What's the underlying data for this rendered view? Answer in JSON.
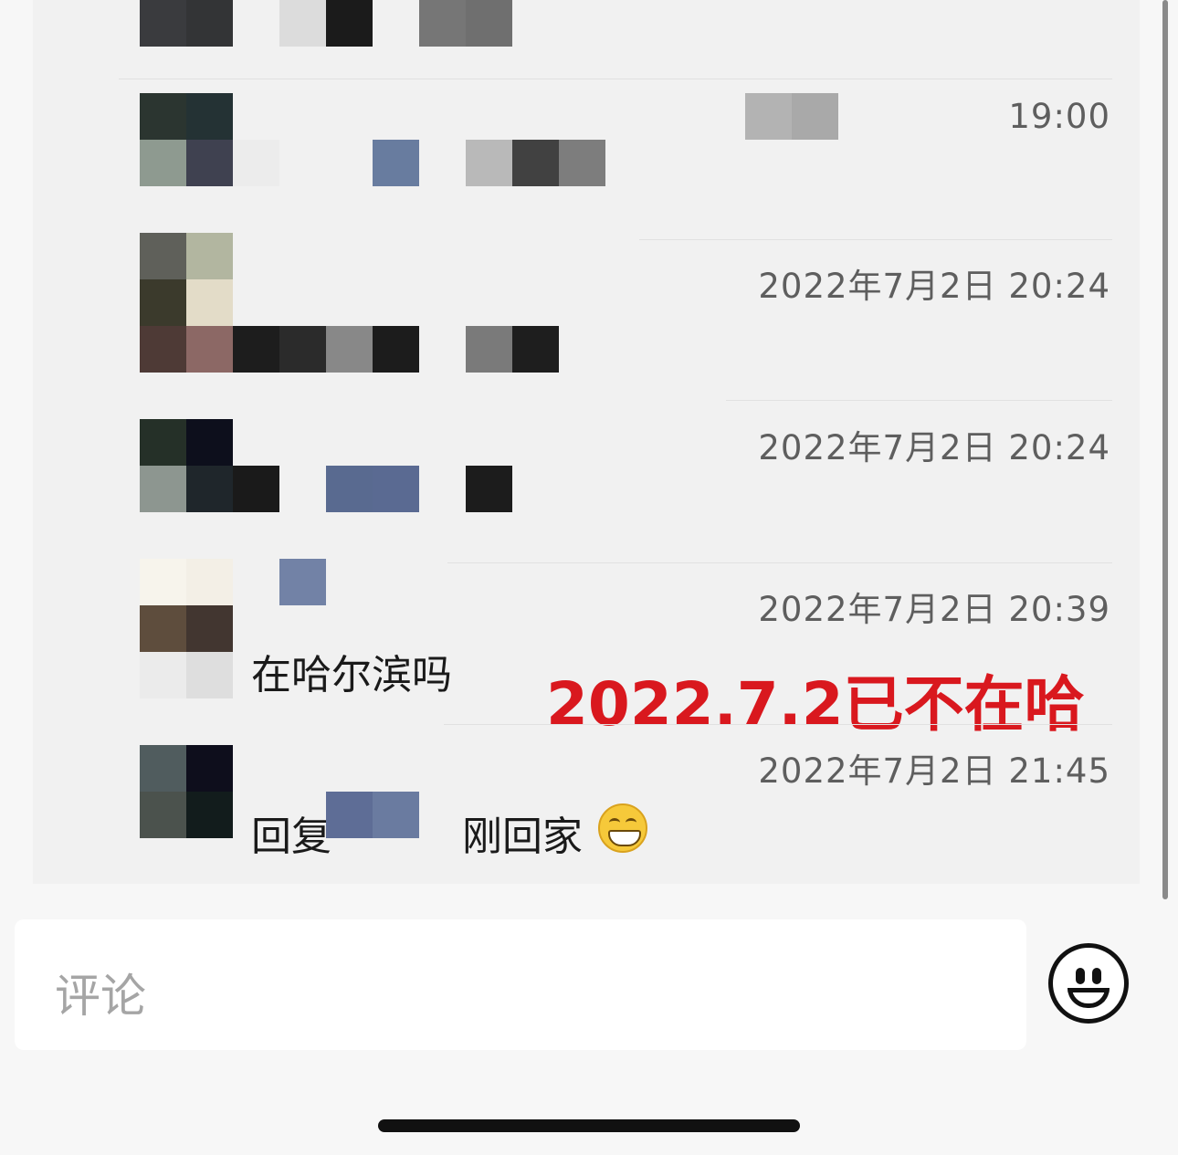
{
  "comments": [
    {
      "timestamp": "19:00"
    },
    {
      "timestamp": "2022年7月2日 20:24"
    },
    {
      "timestamp": "2022年7月2日 20:24"
    },
    {
      "timestamp": "2022年7月2日 20:39",
      "text": "在哈尔滨吗"
    },
    {
      "timestamp": "2022年7月2日 21:45",
      "reply_prefix": "回复",
      "text": "刚回家",
      "emoji": "grinning-emoji"
    }
  ],
  "annotation": "2022.7.2已不在哈",
  "comment_input": {
    "placeholder": "评论"
  },
  "emoji_button": {
    "icon": "smiley-face-icon"
  },
  "colors": {
    "annotation": "#d9181e",
    "background": "#f1f1f1"
  }
}
